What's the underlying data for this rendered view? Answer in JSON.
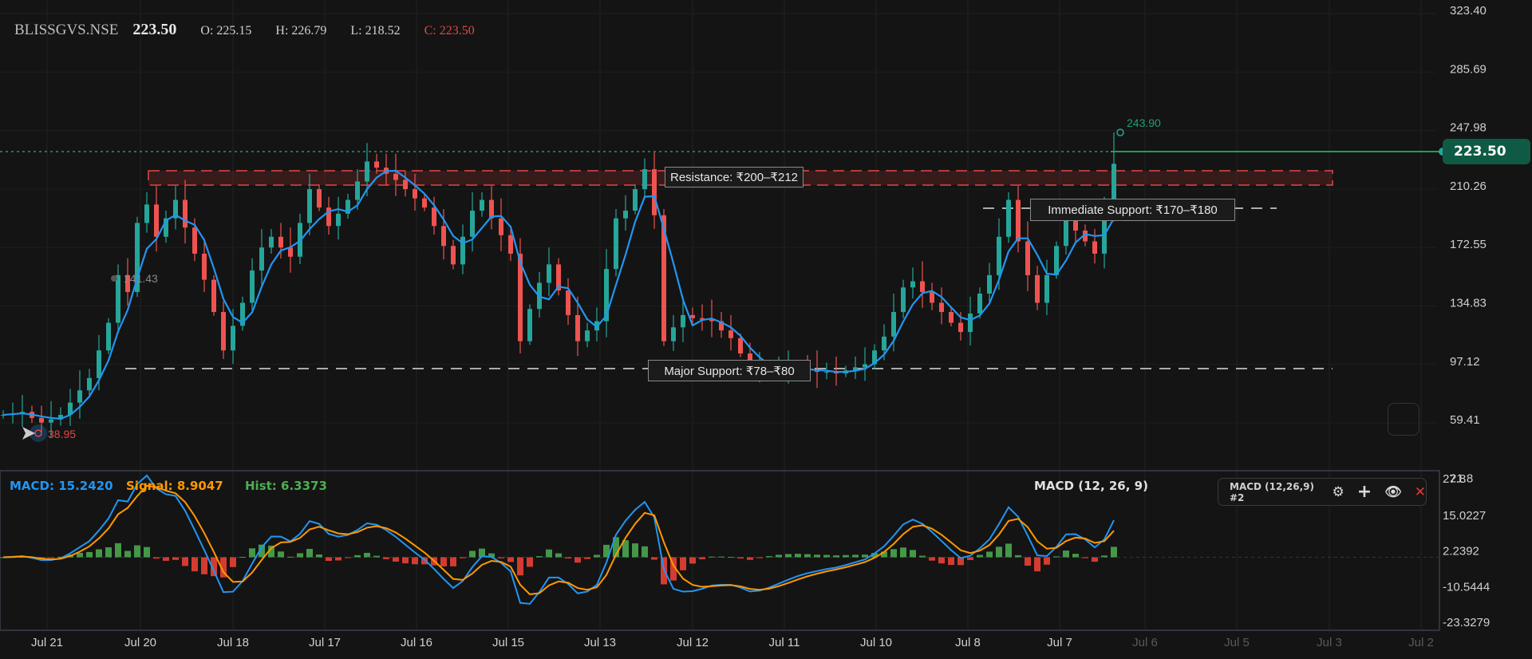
{
  "header": {
    "symbol": "BLISSGVS.NSE",
    "last": "223.50",
    "open": "O: 225.15",
    "high": "H: 226.79",
    "low": "L: 218.52",
    "close": "C: 223.50"
  },
  "price_badge": "223.50",
  "colors": {
    "up": "#26a69a",
    "down": "#ef5350",
    "ma": "#2196f3",
    "signal": "#ff9800",
    "hist_up": "#4caf50",
    "hist_down": "#f44336",
    "price_line": "#1e9e5a"
  },
  "annotations": {
    "resistance": "Resistance: ₹200–₹212",
    "immediate_support": "Immediate Support: ₹170–₹180",
    "major_support": "Major Support: ₹78–₹80",
    "high_marker": "243.90",
    "low_marker": "38.95",
    "mid_marker": "141.43"
  },
  "macd_legend": {
    "macd": "MACD: 15.2420",
    "signal": "Signal: 8.9047",
    "hist": "Hist: 6.3373",
    "title": "MACD (12, 26, 9)"
  },
  "macd_widget": {
    "label": "MACD (12,26,9) #2",
    "icons": [
      "gear-icon",
      "plus-icon",
      "eye-icon",
      "close-icon"
    ]
  },
  "chart_data": [
    {
      "type": "candlestick",
      "price_axis_ticks": [
        "323.40",
        "285.69",
        "247.98",
        "210.26",
        "172.55",
        "134.83",
        "97.12",
        "59.41",
        "21.8"
      ],
      "x_tick_labels": [
        "Jul 21",
        "Jul 20",
        "Jul 18",
        "Jul 17",
        "Jul 16",
        "Jul 15",
        "Jul 13",
        "Jul 12",
        "Jul 11",
        "Jul 10",
        "Jul 8",
        "Jul 7",
        "Jul 6",
        "Jul 5",
        "Jul 3",
        "Jul 2"
      ],
      "ylim": [
        21.8,
        323.4
      ],
      "close": [
        60,
        61,
        62,
        58,
        55,
        57,
        60,
        68,
        76,
        84,
        102,
        120,
        151,
        140,
        185,
        197,
        176,
        188,
        200,
        182,
        165,
        148,
        127,
        102,
        118,
        133,
        154,
        169,
        176,
        169,
        163,
        185,
        207,
        195,
        183,
        191,
        200,
        212,
        225,
        221,
        217,
        213,
        207,
        201,
        195,
        183,
        170,
        158,
        176,
        193,
        200,
        188,
        177,
        165,
        108,
        129,
        146,
        158,
        141,
        125,
        108,
        115,
        121,
        155,
        188,
        193,
        207,
        220,
        190,
        108,
        117,
        125,
        123,
        122,
        121,
        115,
        110,
        100,
        90,
        90,
        90,
        90,
        90,
        90,
        89,
        88,
        88,
        87,
        89,
        91,
        93,
        102,
        111,
        127,
        143,
        147,
        140,
        133,
        127,
        120,
        114,
        126,
        139,
        151,
        176,
        200,
        173,
        151,
        133,
        151,
        170,
        188,
        180,
        173,
        165,
        190,
        223.5
      ],
      "last_high": 243.9
    },
    {
      "type": "macd",
      "axis_ticks": [
        "27.8",
        "15.0227",
        "2.2392",
        "-10.5444",
        "-23.3279"
      ],
      "ylim": [
        -23.3279,
        27.8
      ]
    }
  ]
}
